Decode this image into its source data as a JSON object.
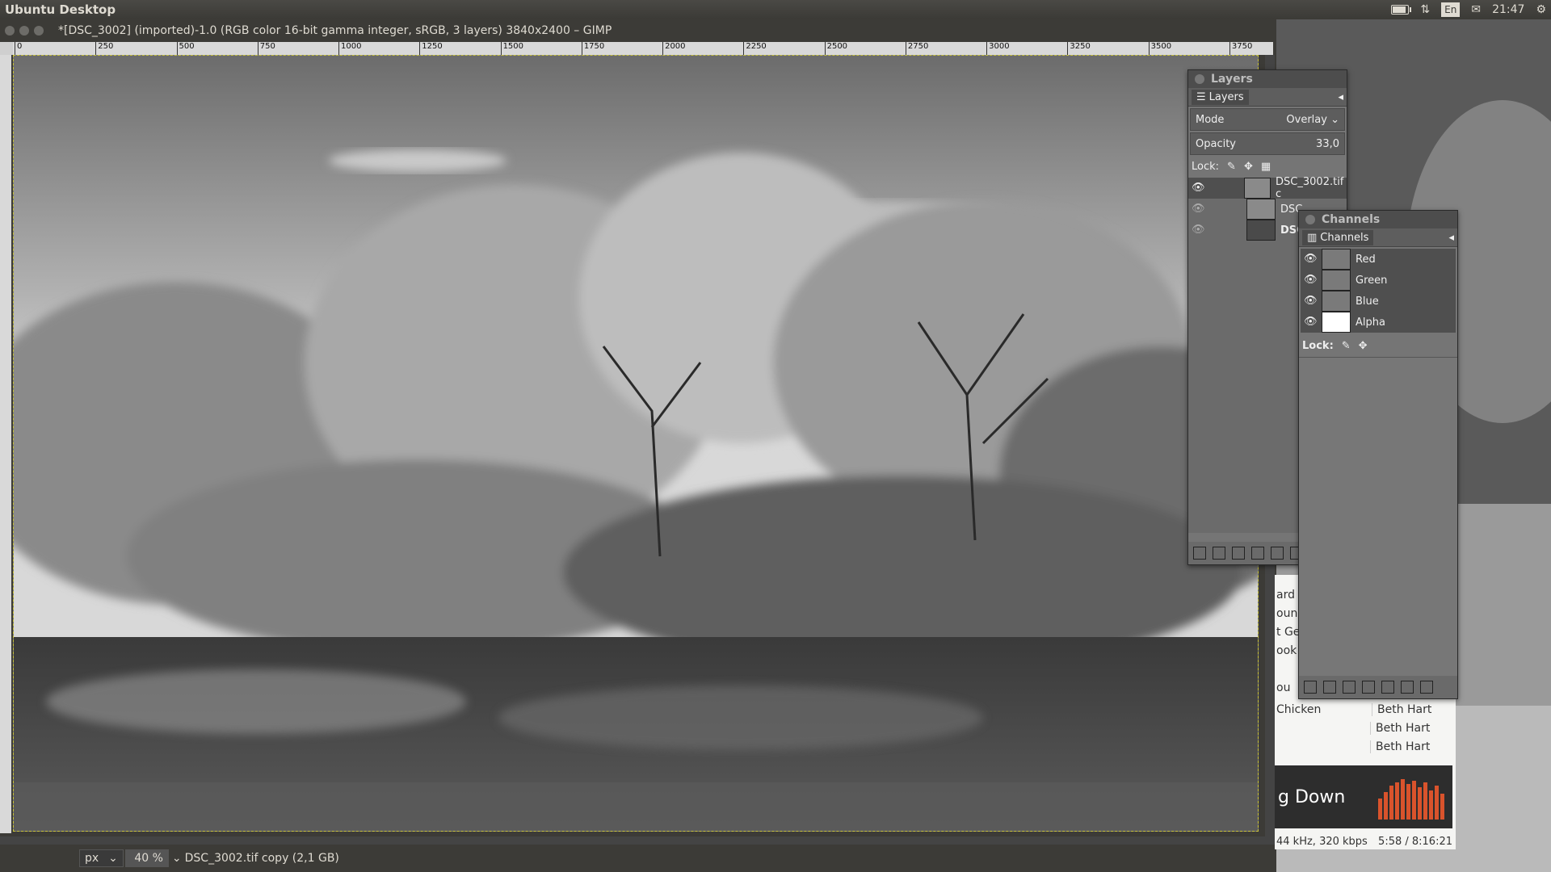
{
  "top_panel": {
    "app_name": "Ubuntu Desktop",
    "keyboard": "En",
    "time": "21:47",
    "icons": [
      "battery-icon",
      "network-arrows-icon",
      "mail-icon",
      "settings-gear-icon"
    ]
  },
  "gimp": {
    "title": "*[DSC_3002] (imported)-1.0 (RGB color 16-bit gamma integer, sRGB, 3 layers) 3840x2400 – GIMP",
    "ruler_ticks": [
      "0",
      "250",
      "500",
      "750",
      "1000",
      "1250",
      "1500",
      "1750",
      "2000",
      "2250",
      "2500",
      "2750",
      "3000",
      "3250",
      "3500",
      "3750"
    ],
    "status": {
      "unit": "px",
      "zoom": "40 %",
      "layer_info": "DSC_3002.tif copy (2,1 GB)"
    }
  },
  "layers_dock": {
    "window_title": "Layers",
    "tab_label": "Layers",
    "mode_label": "Mode",
    "mode_value": "Overlay",
    "opacity_label": "Opacity",
    "opacity_value": "33,0",
    "lock_label": "Lock:",
    "layers": [
      {
        "name": "DSC_3002.tif c",
        "visible": true
      },
      {
        "name": "DSC",
        "visible": false
      },
      {
        "name": "DSC",
        "visible": false
      }
    ]
  },
  "channels_dock": {
    "window_title": "Channels",
    "tab_label": "Channels",
    "channels": [
      {
        "name": "Red"
      },
      {
        "name": "Green"
      },
      {
        "name": "Blue"
      },
      {
        "name": "Alpha"
      }
    ],
    "lock_label": "Lock:"
  },
  "music_player": {
    "list_fragments": [
      "ard",
      "oung",
      "t Ge",
      "ook",
      "ou"
    ],
    "tracks": [
      {
        "title": "Chicken",
        "artist": "Beth Hart"
      },
      {
        "title": "",
        "artist": "Beth Hart"
      },
      {
        "title": "",
        "artist": "Beth Hart"
      }
    ],
    "now_playing": "g Down",
    "audio_info": "44 kHz, 320 kbps",
    "time": "5:58 / 8:16:21"
  }
}
